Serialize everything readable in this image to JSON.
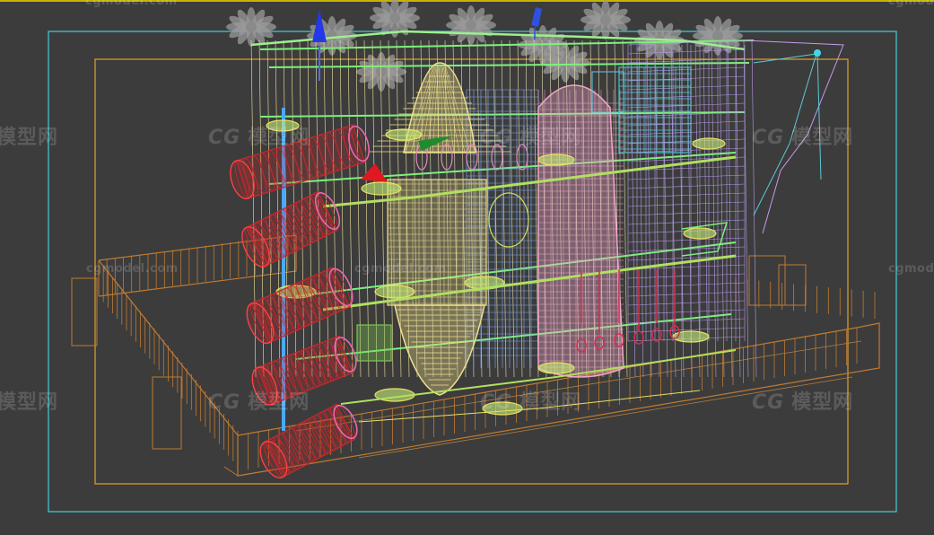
{
  "viewport": {
    "background": "#3c3c3c",
    "safe_frame_outer_color": "#3fd0d8",
    "safe_frame_inner_color": "#e0a030",
    "top_edge_color": "#c8b400"
  },
  "watermark": {
    "url_text": "cgmodel.com",
    "logo_glyph": "CG",
    "logo_text": "模型网"
  },
  "icons": {
    "gizmo_up": "z-axis-arrow-icon",
    "gizmo_camera": "y-axis-arrow-icon",
    "gizmo_green": "x-cone-icon",
    "gizmo_red": "red-cone-icon"
  },
  "colors": {
    "slide": "#c8282c",
    "tower_yellow": "#f0e08a",
    "tower_pink": "#f2a6c8",
    "frame_green": "#7cf07c",
    "frame_blue": "#7fa8f0",
    "fence_orange": "#c07a30",
    "palm_grey": "#9a9a9a",
    "cyan_mesh": "#5fc8d8",
    "purple_mesh": "#b89ae8"
  }
}
